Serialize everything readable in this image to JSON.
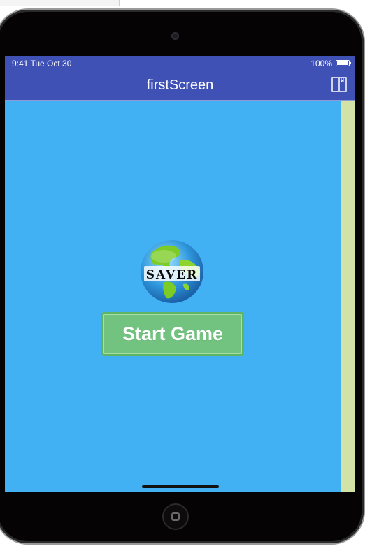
{
  "status_bar": {
    "time": "9:41 Tue Oct 30",
    "battery_percent": "100%"
  },
  "app_bar": {
    "title": "firstScreen",
    "icon": "book-icon"
  },
  "logo": {
    "text": "SAVER",
    "icon": "globe-icon"
  },
  "main": {
    "start_button_label": "Start Game"
  },
  "colors": {
    "app_bar": "#3f51b5",
    "background": "#42b1f4",
    "side_strip": "#d3e2a7",
    "button": "#71c37f",
    "device": "#060304"
  }
}
